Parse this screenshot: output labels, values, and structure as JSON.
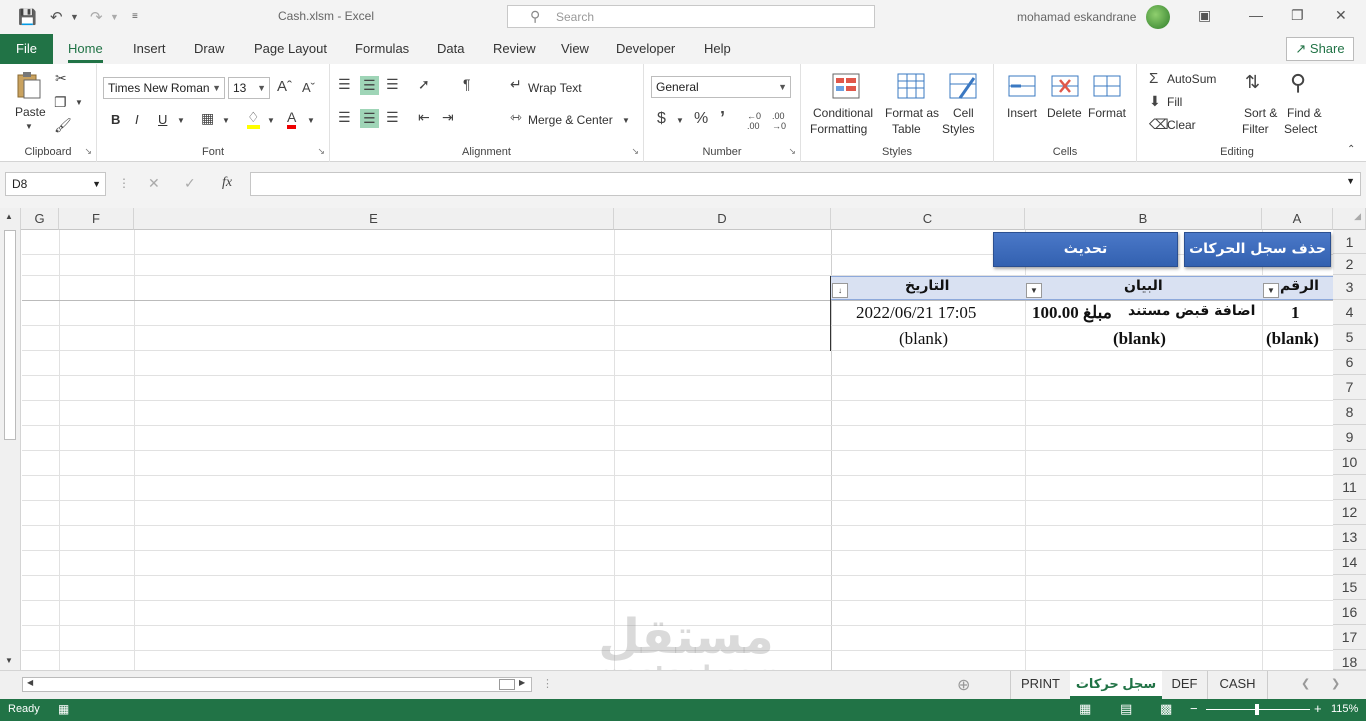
{
  "titlebar": {
    "title": "Cash.xlsm  -  Excel",
    "search_placeholder": "Search",
    "user": "mohamad eskandrane"
  },
  "tabs": [
    "File",
    "Home",
    "Insert",
    "Draw",
    "Page Layout",
    "Formulas",
    "Data",
    "Review",
    "View",
    "Developer",
    "Help"
  ],
  "share_label": "Share",
  "ribbon": {
    "clipboard": {
      "paste": "Paste",
      "label": "Clipboard"
    },
    "font": {
      "name": "Times New Roman",
      "size": "13",
      "bold": "B",
      "italic": "I",
      "underline": "U",
      "label": "Font"
    },
    "alignment": {
      "wrap": "Wrap Text",
      "merge": "Merge & Center",
      "label": "Alignment"
    },
    "number": {
      "format": "General",
      "label": "Number"
    },
    "styles": {
      "cond1": "Conditional",
      "cond2": "Formatting",
      "fmt1": "Format as",
      "fmt2": "Table",
      "cell1": "Cell",
      "cell2": "Styles",
      "label": "Styles"
    },
    "cells": {
      "insert": "Insert",
      "delete": "Delete",
      "format": "Format",
      "label": "Cells"
    },
    "editing": {
      "autosum": "AutoSum",
      "fill": "Fill",
      "clear": "Clear",
      "sort1": "Sort &",
      "sort2": "Filter",
      "find1": "Find &",
      "find2": "Select",
      "label": "Editing"
    }
  },
  "formula_bar": {
    "name_box": "D8",
    "fx": "fx",
    "content": ""
  },
  "columns": [
    {
      "label": "G"
    },
    {
      "label": "F"
    },
    {
      "label": "E"
    },
    {
      "label": "D"
    },
    {
      "label": "C"
    },
    {
      "label": "B"
    },
    {
      "label": "A"
    }
  ],
  "rows": [
    "1",
    "2",
    "3",
    "4",
    "5",
    "6",
    "7",
    "8",
    "9",
    "10",
    "11",
    "12",
    "13",
    "14",
    "15",
    "16",
    "17",
    "18"
  ],
  "buttons": {
    "delete_log": "حذف سجل الحركات",
    "refresh": "تحديث"
  },
  "table": {
    "headers": {
      "a": "الرقم",
      "b": "البيان",
      "c": "التاريخ"
    },
    "row4": {
      "a": "1",
      "b_text": "اضافة قبض مستند",
      "b_amount": "مبلغ 100.00",
      "c": "2022/06/21 17:05"
    },
    "row5": {
      "a": "(blank)",
      "b": "(blank)",
      "c": "(blank)"
    }
  },
  "sheets": [
    "PRINT",
    "سجل حركات",
    "DEF",
    "CASH"
  ],
  "active_sheet": "سجل حركات",
  "status": {
    "ready": "Ready",
    "zoom": "115%"
  },
  "watermark": {
    "main": "مستقل",
    "sub": "mostaql.com"
  }
}
